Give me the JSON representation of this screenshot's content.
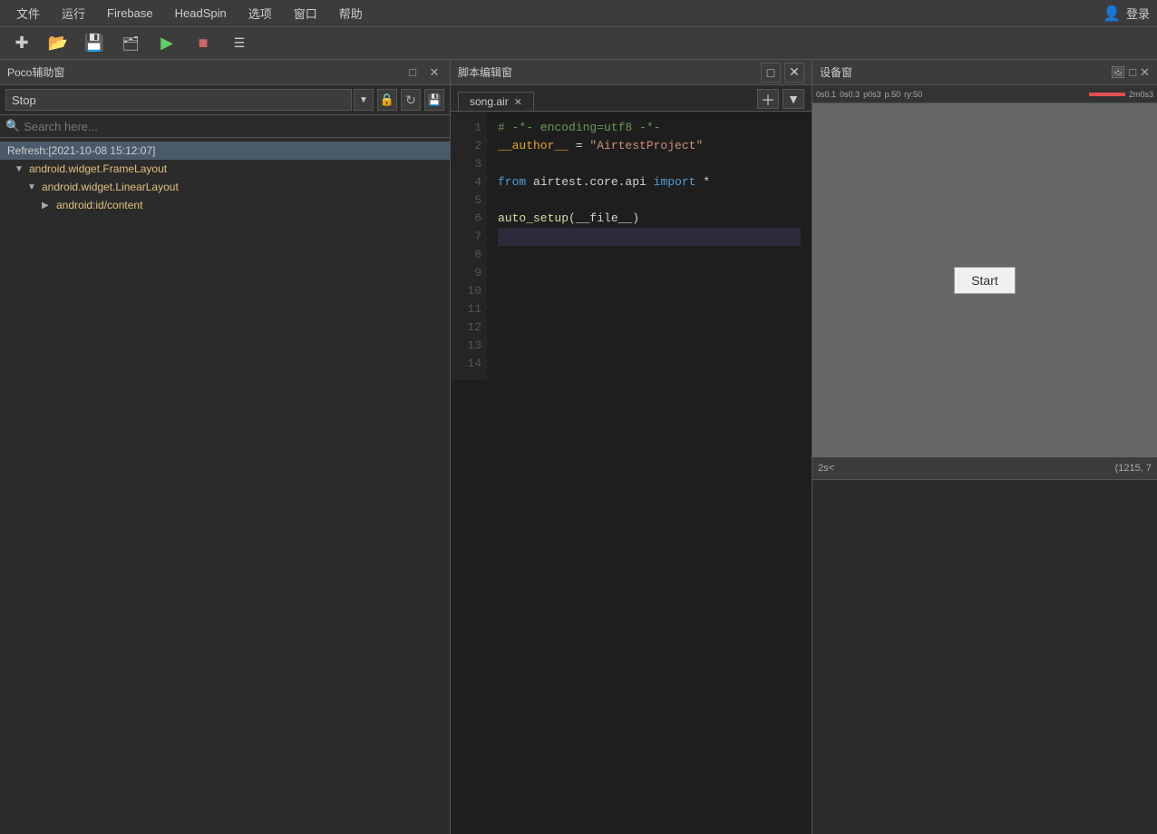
{
  "menubar": {
    "items": [
      "文件",
      "运行",
      "Firebase",
      "HeadSpin",
      "选项",
      "窗口",
      "帮助"
    ],
    "login_label": "登录"
  },
  "toolbar": {
    "buttons": [
      "new",
      "open",
      "save",
      "save-all",
      "run",
      "stop",
      "record"
    ]
  },
  "poco_panel": {
    "title": "Poco辅助窗",
    "dropdown_value": "Stop",
    "search_placeholder": "Search here...",
    "refresh_item": "Refresh:[2021-10-08 15:12:07]",
    "tree": [
      {
        "label": "android.widget.FrameLayout",
        "level": 0,
        "expanded": true
      },
      {
        "label": "android.widget.LinearLayout",
        "level": 1,
        "expanded": true
      },
      {
        "label": "android:id/content",
        "level": 2,
        "expanded": false
      }
    ]
  },
  "editor_panel": {
    "title": "脚本编辑窗",
    "tab_name": "song.air",
    "lines": [
      {
        "num": 1,
        "code": "# -*- encoding=utf8 -*-",
        "type": "comment"
      },
      {
        "num": 2,
        "code": "__author__ = \"AirtestProject\"",
        "type": "assignment"
      },
      {
        "num": 3,
        "code": "",
        "type": "empty"
      },
      {
        "num": 4,
        "code": "from airtest.core.api import *",
        "type": "import"
      },
      {
        "num": 5,
        "code": "",
        "type": "empty"
      },
      {
        "num": 6,
        "code": "auto_setup(__file__)",
        "type": "call"
      },
      {
        "num": 7,
        "code": "",
        "type": "empty"
      },
      {
        "num": 8,
        "code": "",
        "type": "empty"
      },
      {
        "num": 9,
        "code": "",
        "type": "empty"
      },
      {
        "num": 10,
        "code": "",
        "type": "empty"
      },
      {
        "num": 11,
        "code": "",
        "type": "empty"
      },
      {
        "num": 12,
        "code": "",
        "type": "empty"
      },
      {
        "num": 13,
        "code": "",
        "type": "empty"
      },
      {
        "num": 14,
        "code": "",
        "type": "empty"
      }
    ]
  },
  "device_panel": {
    "title": "设备窗",
    "timeline_marks": [
      "0s0.1",
      "0s0.3",
      "p0s3",
      "p.50",
      "ry:50",
      "2m0s3"
    ],
    "start_button_label": "Start",
    "bottom_label": "2s<",
    "coords": "(1215, 7"
  }
}
